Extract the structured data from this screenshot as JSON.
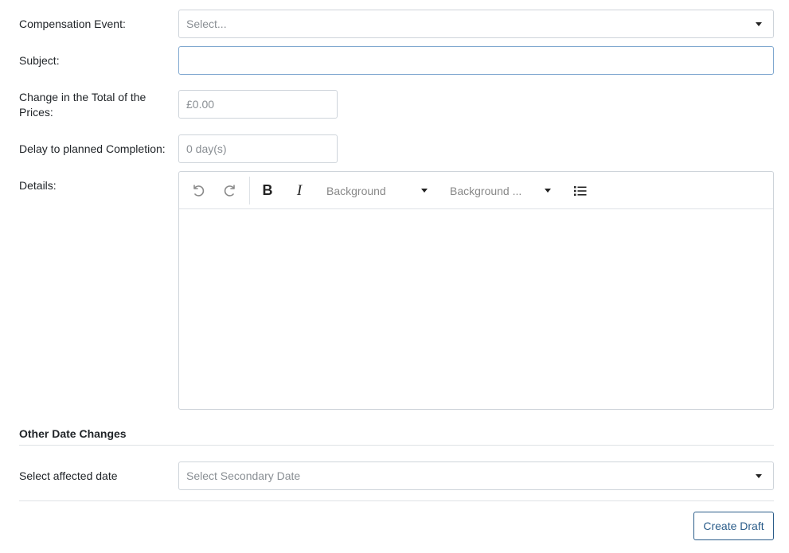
{
  "form": {
    "compensation_event": {
      "label": "Compensation Event:",
      "placeholder": "Select..."
    },
    "subject": {
      "label": "Subject:",
      "value": ""
    },
    "price_change": {
      "label": "Change in the Total of the Prices:",
      "placeholder": "£0.00"
    },
    "delay": {
      "label": "Delay to planned Completion:",
      "placeholder": "0 day(s)"
    },
    "details": {
      "label": "Details:",
      "toolbar": {
        "undo_icon": "undo-icon",
        "redo_icon": "redo-icon",
        "bold_label": "B",
        "italic_label": "I",
        "background_select": "Background",
        "background_color_select": "Background ...",
        "list_icon": "bulleted-list-icon"
      },
      "content": ""
    }
  },
  "other_dates": {
    "section_title": "Other Date Changes",
    "affected_date": {
      "label": "Select affected date",
      "placeholder": "Select Secondary Date"
    }
  },
  "actions": {
    "create_draft_label": "Create Draft"
  },
  "colors": {
    "primary": "#2b5d8a",
    "border": "#ced4da",
    "placeholder": "#8a8f94"
  }
}
